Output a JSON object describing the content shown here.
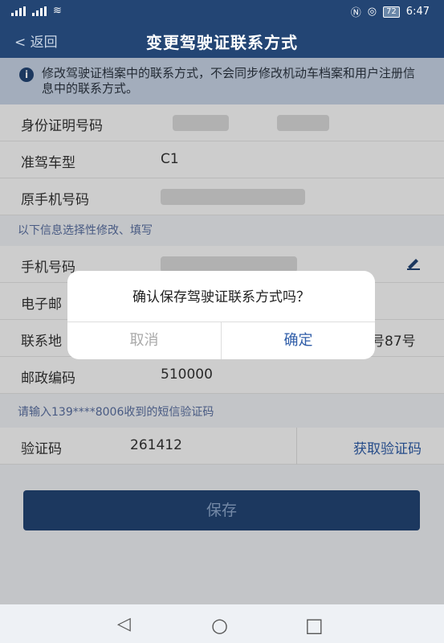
{
  "status_bar": {
    "time": "6:47",
    "battery": "72"
  },
  "nav": {
    "back_label": "返回",
    "title": "变更驾驶证联系方式"
  },
  "notice": {
    "text": "修改驾驶证档案中的联系方式，不会同步修改机动车档案和用户注册信息中的联系方式。"
  },
  "fields": {
    "id_label": "身份证明号码",
    "license_type_label": "准驾车型",
    "license_type_value": "C1",
    "orig_phone_label": "原手机号码",
    "section_hint": "以下信息选择性修改、填写",
    "phone_label": "手机号码",
    "email_label_partial": "电子邮",
    "address_label_partial": "联系地",
    "address_value_partial": "号87号",
    "postcode_label": "邮政编码",
    "postcode_value": "510000",
    "sms_hint": "请输入139****8006收到的短信验证码",
    "code_label": "验证码",
    "code_value": "261412",
    "get_code_label": "获取验证码"
  },
  "save_label": "保存",
  "dialog": {
    "message": "确认保存驾驶证联系方式吗？",
    "cancel_label": "取消",
    "confirm_label": "确定"
  },
  "nav_keys": {
    "back": "◁",
    "home": "○",
    "recents": "□"
  },
  "colors": {
    "primary": "#234574",
    "link": "#2f5da8"
  }
}
